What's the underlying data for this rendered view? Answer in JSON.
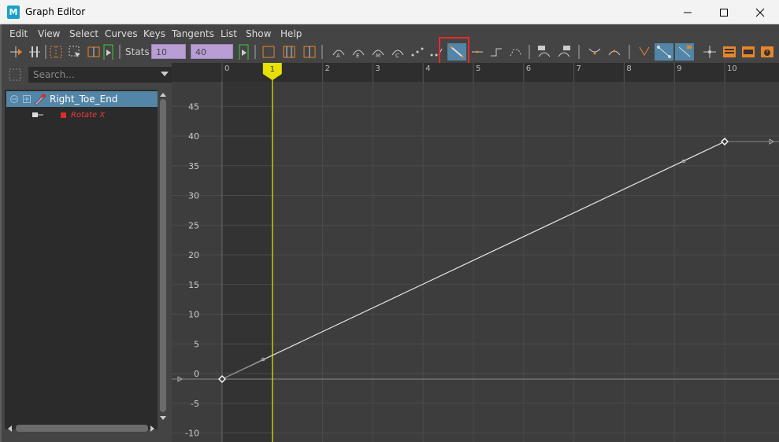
{
  "window": {
    "title": "Graph Editor",
    "logo": "M"
  },
  "menu": [
    "Edit",
    "View",
    "Select",
    "Curves",
    "Keys",
    "Tangents",
    "List",
    "Show",
    "Help"
  ],
  "toolbar": {
    "stats_label": "Stats",
    "stats_frame": "10",
    "stats_value": "40",
    "active_tool": "linear-tangent-icon"
  },
  "outliner": {
    "search_placeholder": "Search...",
    "node": "Right_Toe_End",
    "attribute": "Rotate X",
    "attribute_color": "#e02a2a"
  },
  "graph": {
    "current_frame": "1",
    "x_ticks": [
      "0",
      "1",
      "2",
      "3",
      "4",
      "5",
      "6",
      "7",
      "8",
      "9",
      "10"
    ],
    "y_ticks": [
      "45",
      "40",
      "35",
      "30",
      "25",
      "20",
      "15",
      "10",
      "5",
      "0",
      "-5",
      "-10"
    ],
    "curve_color": "#e6e6e6",
    "time_marker_color": "#e8e100"
  },
  "chart_data": {
    "type": "line",
    "x": [
      0,
      10
    ],
    "y": [
      0,
      40
    ],
    "xlim": [
      0,
      10
    ],
    "ylim": [
      -10,
      45
    ],
    "keys": [
      {
        "frame": 0,
        "value": 0
      },
      {
        "frame": 10,
        "value": 40
      }
    ],
    "current_frame": 1
  }
}
